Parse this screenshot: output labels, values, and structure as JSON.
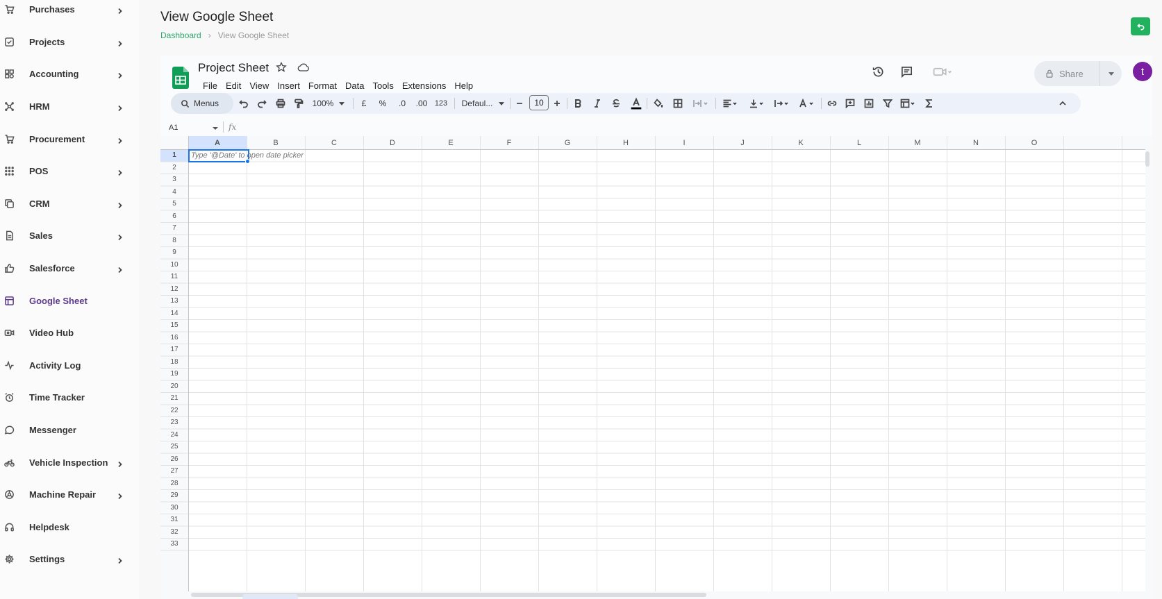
{
  "sidebar": {
    "items": [
      {
        "label": "Purchases",
        "icon": "cart-icon",
        "chevron": true
      },
      {
        "label": "Projects",
        "icon": "checkbox-icon",
        "chevron": true
      },
      {
        "label": "Accounting",
        "icon": "apps-icon",
        "chevron": true
      },
      {
        "label": "HRM",
        "icon": "users-icon",
        "chevron": true
      },
      {
        "label": "Procurement",
        "icon": "cart-icon",
        "chevron": true
      },
      {
        "label": "POS",
        "icon": "grid-dots-icon",
        "chevron": true
      },
      {
        "label": "CRM",
        "icon": "copy-icon",
        "chevron": true
      },
      {
        "label": "Sales",
        "icon": "file-icon",
        "chevron": true
      },
      {
        "label": "Salesforce",
        "icon": "thumb-up-icon",
        "chevron": true
      },
      {
        "label": "Google Sheet",
        "icon": "table-icon",
        "chevron": false,
        "active": true
      },
      {
        "label": "Video Hub",
        "icon": "video-icon",
        "chevron": false
      },
      {
        "label": "Activity Log",
        "icon": "activity-icon",
        "chevron": false
      },
      {
        "label": "Time Tracker",
        "icon": "alarm-icon",
        "chevron": false
      },
      {
        "label": "Messenger",
        "icon": "message-icon",
        "chevron": false
      },
      {
        "label": "Vehicle Inspection",
        "icon": "bike-icon",
        "chevron": true
      },
      {
        "label": "Machine Repair",
        "icon": "tool-icon",
        "chevron": true
      },
      {
        "label": "Helpdesk",
        "icon": "headset-icon",
        "chevron": false
      },
      {
        "label": "Settings",
        "icon": "gear-icon",
        "chevron": true
      }
    ]
  },
  "header": {
    "title": "View Google Sheet",
    "breadcrumb": {
      "home": "Dashboard",
      "current": "View Google Sheet"
    }
  },
  "sheet": {
    "doc_title": "Project Sheet",
    "menu": [
      "File",
      "Edit",
      "View",
      "Insert",
      "Format",
      "Data",
      "Tools",
      "Extensions",
      "Help"
    ],
    "share_label": "Share",
    "avatar_letter": "t",
    "toolbar": {
      "menus_label": "Menus",
      "zoom": "100%",
      "currency": "£",
      "percent": "%",
      "dec_decrease": ".0",
      "dec_increase": ".00",
      "number_format": "123",
      "font": "Defaul...",
      "font_size": "10"
    },
    "name_box": "A1",
    "fx": "fx",
    "columns": [
      "A",
      "B",
      "C",
      "D",
      "E",
      "F",
      "G",
      "H",
      "I",
      "J",
      "K",
      "L",
      "M",
      "N",
      "O"
    ],
    "rows": [
      "1",
      "2",
      "3",
      "4",
      "5",
      "6",
      "7",
      "8",
      "9",
      "10",
      "11",
      "12",
      "13",
      "14",
      "15",
      "16",
      "17",
      "18",
      "19",
      "20",
      "21",
      "22",
      "23",
      "24",
      "25",
      "26",
      "27",
      "28",
      "29",
      "30",
      "31",
      "32",
      "33"
    ],
    "cell_hint": "Type '@Date' to open date picker"
  },
  "colors": {
    "accent_green": "#22b25f",
    "breadcrumb_green": "#2ea86b",
    "active_purple": "#5b3a8c",
    "selection_blue": "#1a73e8",
    "avatar_purple": "#7b1fa2"
  }
}
